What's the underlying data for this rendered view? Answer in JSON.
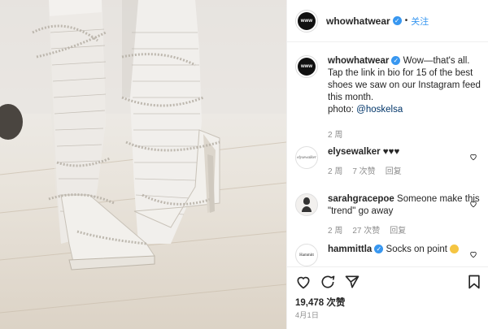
{
  "post": {
    "username": "whowhatwear",
    "avatar_text": "www",
    "follow_label": "关注",
    "separator": "•"
  },
  "caption": {
    "username": "whowhatwear",
    "text": "Wow—that's all. Tap the link in bio for 15 of the best shoes we saw on our Instagram feed this month.",
    "photo_prefix": "photo: ",
    "photo_handle": "@hoskelsa",
    "age": "2 周"
  },
  "comments": [
    {
      "username": "elysewalker",
      "avatar_text": "elysewalker",
      "text": " ♥♥♥",
      "age": "2 周",
      "likes": "7 次赞",
      "reply": "回复"
    },
    {
      "username": "sarahgracepoe",
      "text": " Someone make this \"trend\" go away",
      "age": "2 周",
      "likes": "27 次赞",
      "reply": "回复"
    },
    {
      "username": "hammittla",
      "avatar_text": "Hammitt",
      "text": " Socks on point ",
      "emoji": "smiling-face-emoji"
    }
  ],
  "footer": {
    "likes": "19,478 次赞",
    "date": "4月1日"
  },
  "icons": [
    "heart-icon",
    "comment-icon",
    "share-icon",
    "bookmark-icon",
    "verified-badge-icon"
  ],
  "colors": {
    "link": "#3897f0",
    "text": "#262626",
    "muted": "#8e8e8e",
    "verified": "#3897f0"
  }
}
